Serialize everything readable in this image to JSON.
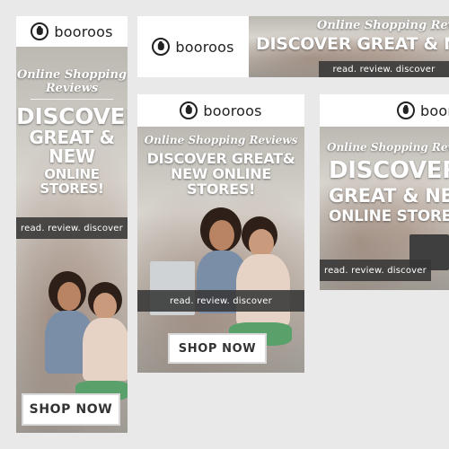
{
  "brand": {
    "name": "booroos",
    "logo_icon": "shopping-bag-icon"
  },
  "ad_copy": {
    "tagline": "Online Shopping Reviews",
    "tagline_split": [
      "Online Shopping",
      "Reviews"
    ],
    "discover": "DISCOVER",
    "great_new": "GREAT & NEW",
    "online_stores": "ONLINE STORES!",
    "discover_great": "DISCOVER GREAT&",
    "new_online_stores": "NEW ONLINE STORES!",
    "leaderboard_headline": "DISCOVER GREAT & NEW ONLINE STORES!",
    "strip": "read. review. discover",
    "cta": "SHOP NOW"
  },
  "colors": {
    "background": "#e9e9e9",
    "strip": "#373737",
    "button_bg": "#ffffff"
  }
}
